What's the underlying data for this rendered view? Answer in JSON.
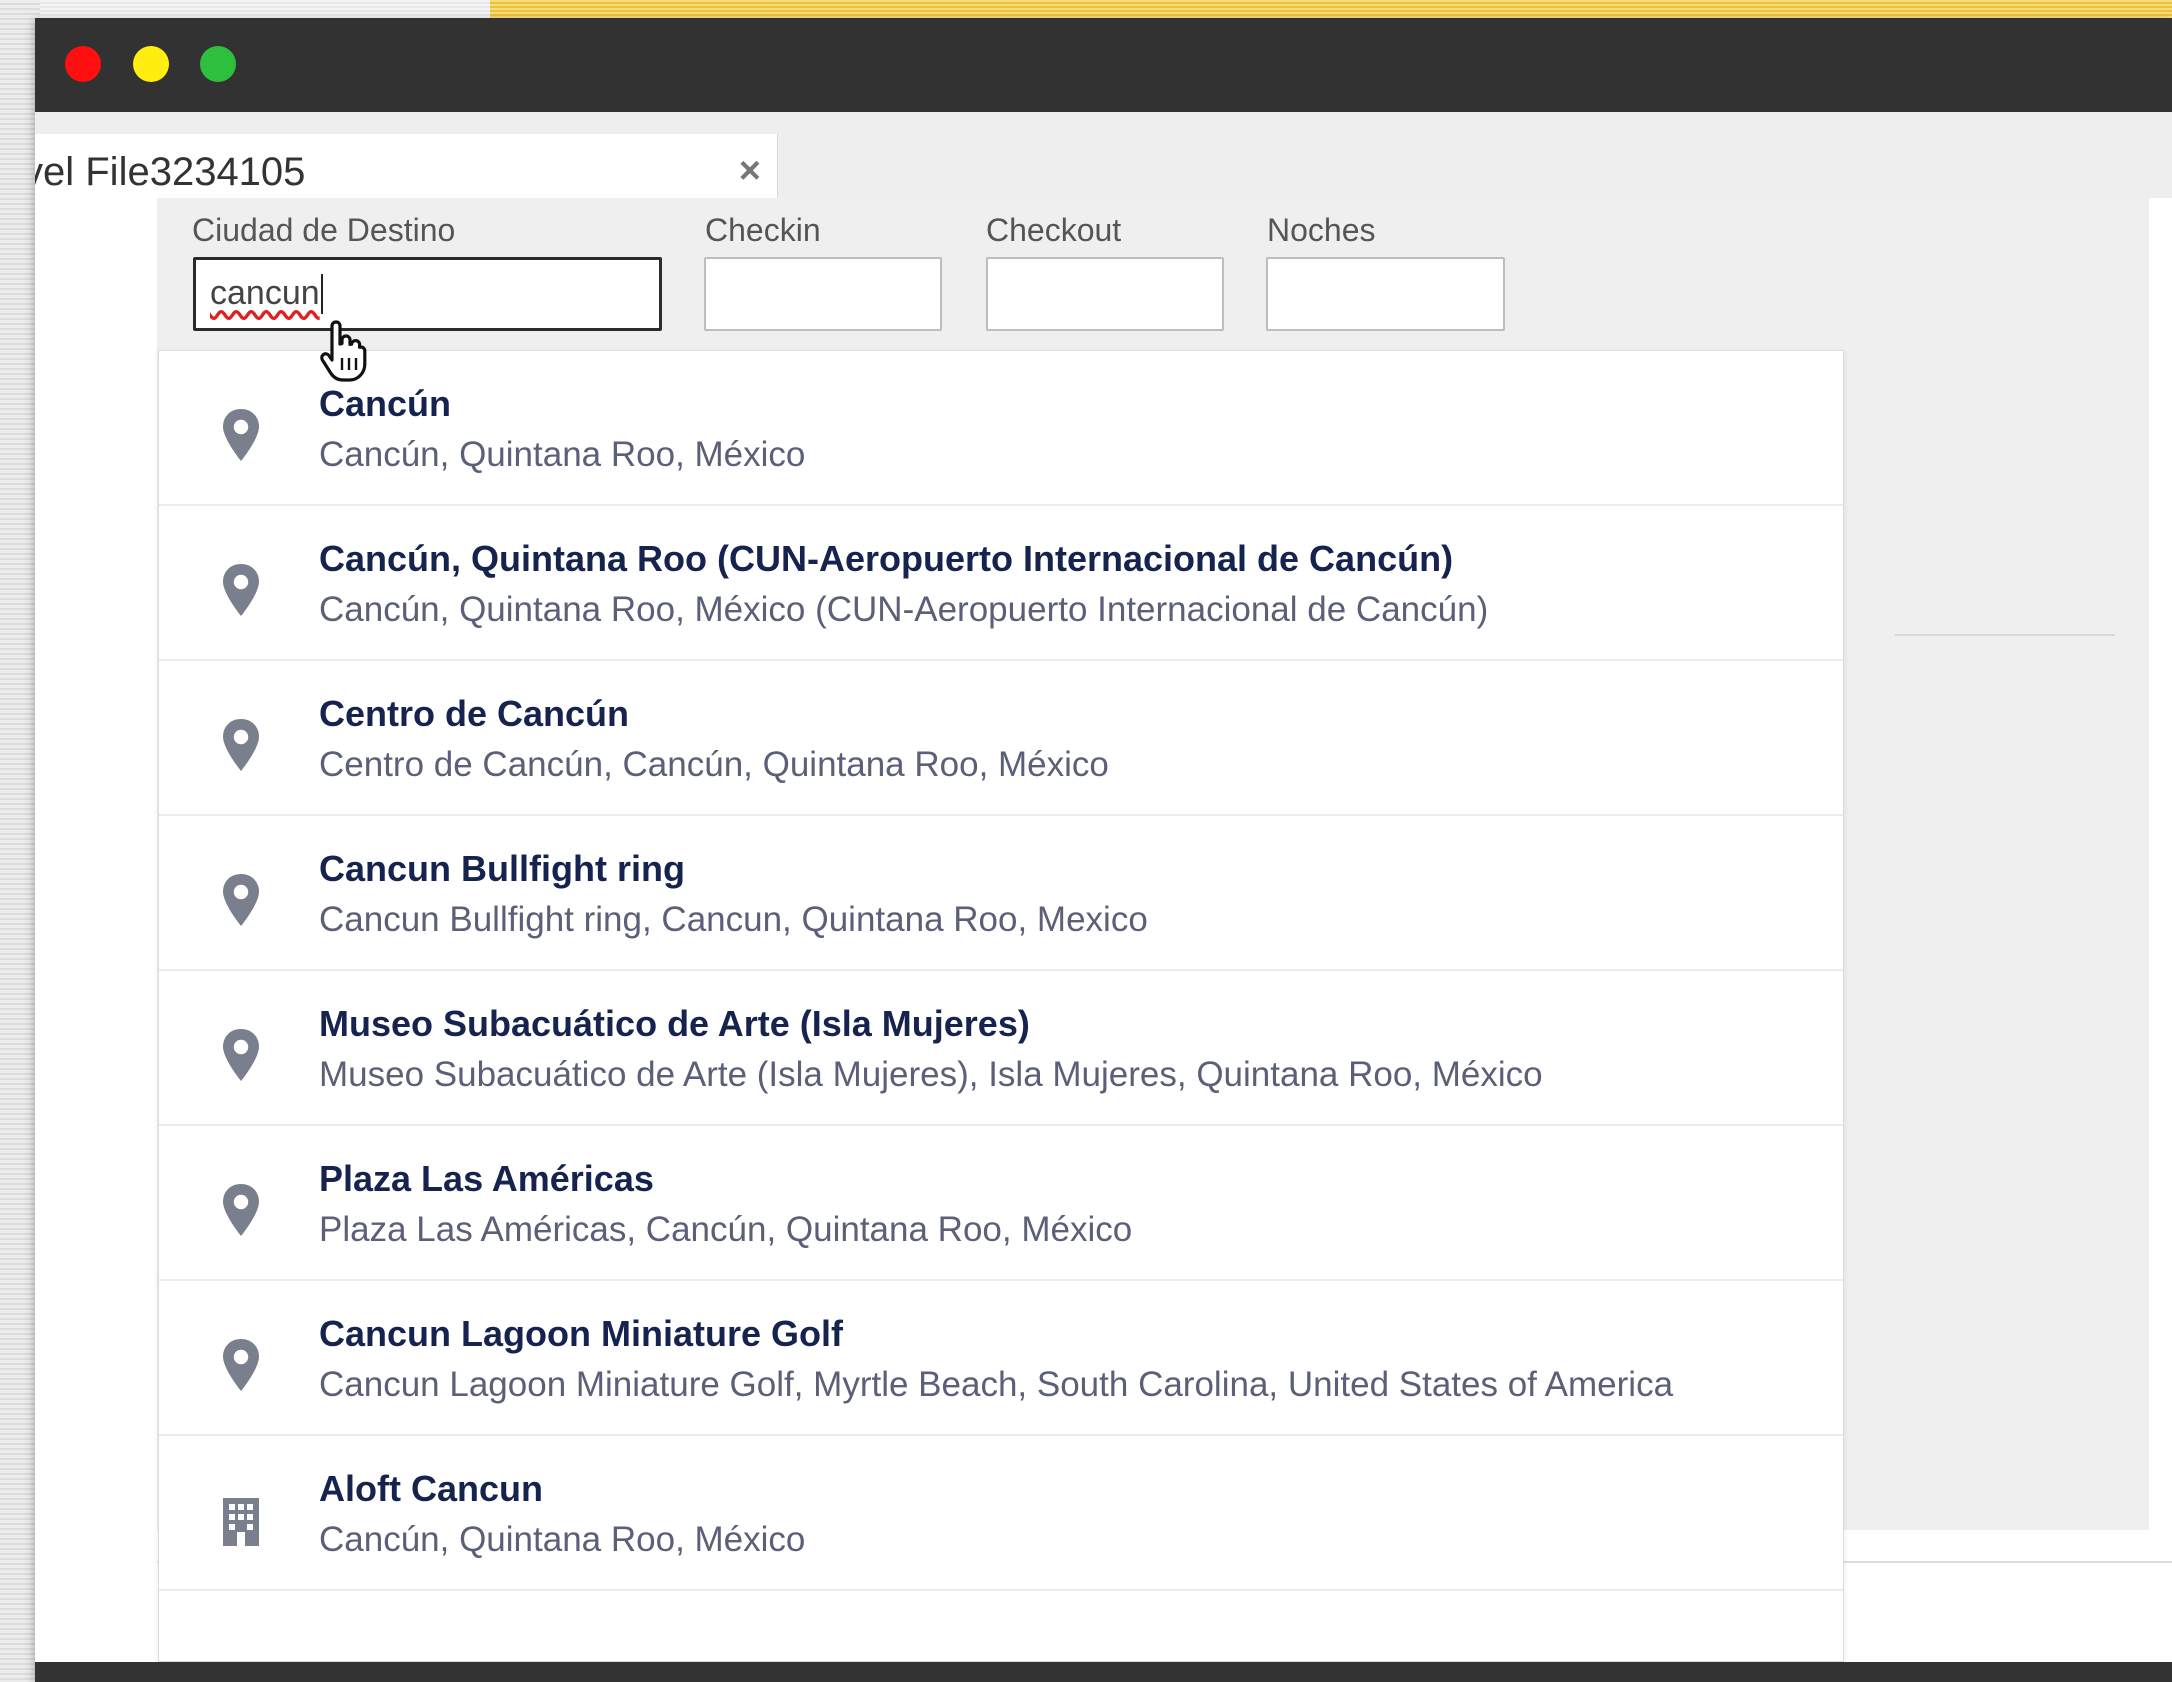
{
  "tab": {
    "label": "vel File3234105",
    "close_symbol": "×"
  },
  "form": {
    "destination": {
      "label": "Ciudad de Destino",
      "value": "cancun"
    },
    "checkin": {
      "label": "Checkin",
      "value": ""
    },
    "checkout": {
      "label": "Checkout",
      "value": ""
    },
    "nights": {
      "label": "Noches",
      "value": ""
    }
  },
  "suggestions": [
    {
      "title": "Cancún",
      "subtitle": "Cancún, Quintana Roo, México",
      "icon": "map-pin-icon"
    },
    {
      "title": "Cancún, Quintana Roo (CUN-Aeropuerto Internacional de Cancún)",
      "subtitle": "Cancún, Quintana Roo, México (CUN-Aeropuerto Internacional de Cancún)",
      "icon": "map-pin-icon"
    },
    {
      "title": "Centro de Cancún",
      "subtitle": "Centro de Cancún, Cancún, Quintana Roo, México",
      "icon": "map-pin-icon"
    },
    {
      "title": "Cancun Bullfight ring",
      "subtitle": "Cancun Bullfight ring, Cancun, Quintana Roo, Mexico",
      "icon": "map-pin-icon"
    },
    {
      "title": "Museo Subacuático de Arte (Isla Mujeres)",
      "subtitle": "Museo Subacuático de Arte (Isla Mujeres), Isla Mujeres, Quintana Roo, México",
      "icon": "map-pin-icon"
    },
    {
      "title": "Plaza Las Américas",
      "subtitle": "Plaza Las Américas, Cancún, Quintana Roo, México",
      "icon": "map-pin-icon"
    },
    {
      "title": "Cancun Lagoon Miniature Golf",
      "subtitle": "Cancun Lagoon Miniature Golf, Myrtle Beach, South Carolina, United States of America",
      "icon": "map-pin-icon"
    },
    {
      "title": "Aloft Cancun",
      "subtitle": "Cancún, Quintana Roo, México",
      "icon": "building-icon"
    }
  ],
  "colors": {
    "suggestion_title": "#16234f",
    "suggestion_subtitle": "#5b5f78",
    "icon": "#7a7f8e",
    "titlebar": "#323232"
  }
}
